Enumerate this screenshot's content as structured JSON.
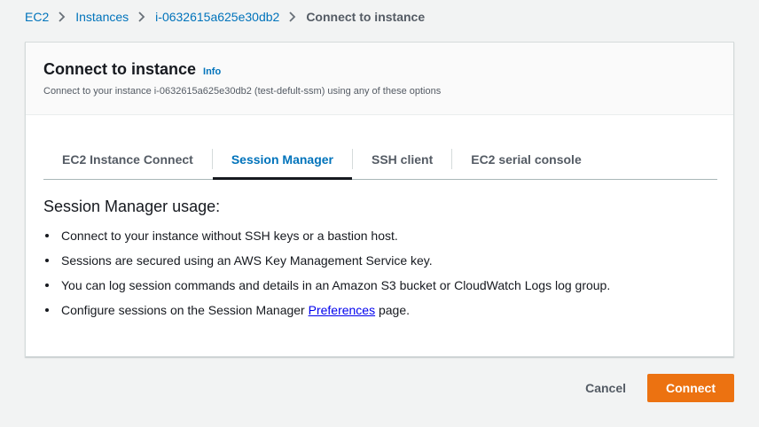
{
  "breadcrumb": {
    "items": [
      "EC2",
      "Instances",
      "i-0632615a625e30db2"
    ],
    "current": "Connect to instance"
  },
  "icons": {
    "separator": "chevron-right-icon"
  },
  "panel": {
    "title": "Connect to instance",
    "info": "Info",
    "description": "Connect to your instance i-0632615a625e30db2 (test-defult-ssm) using any of these options"
  },
  "tabs": [
    {
      "label": "EC2 Instance Connect"
    },
    {
      "label": "Session Manager"
    },
    {
      "label": "SSH client"
    },
    {
      "label": "EC2 serial console"
    }
  ],
  "active_tab": "Session Manager",
  "session_manager": {
    "heading": "Session Manager usage:",
    "bullets": [
      "Connect to your instance without SSH keys or a bastion host.",
      "Sessions are secured using an AWS Key Management Service key.",
      "You can log session commands and details in an Amazon S3 bucket or CloudWatch Logs log group."
    ],
    "last_bullet": {
      "prefix": "Configure sessions on the Session Manager",
      "link": "Preferences",
      "suffix": "page."
    }
  },
  "buttons": {
    "cancel": "Cancel",
    "connect": "Connect"
  },
  "colors": {
    "link": "#0073bb",
    "primary_button": "#ec7211",
    "background": "#f2f3f3",
    "active_tab_underline": "#16191f"
  }
}
